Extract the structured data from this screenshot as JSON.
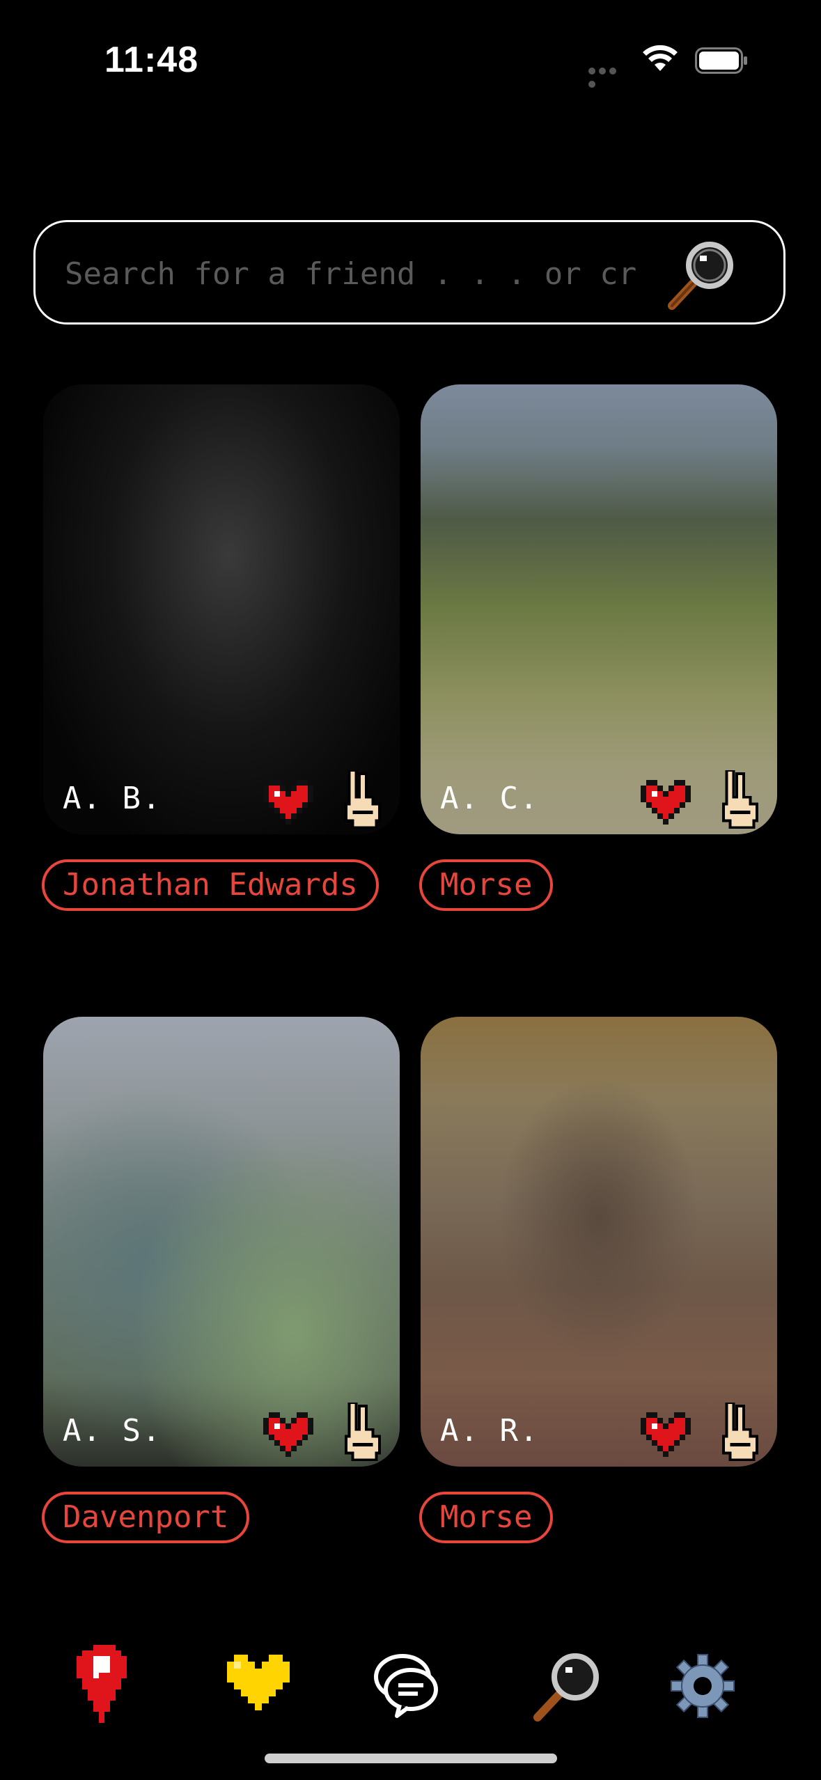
{
  "status_bar": {
    "time": "11:48"
  },
  "search": {
    "placeholder": "Search for a friend . . . or crush"
  },
  "cards": [
    {
      "initials": "A. B.",
      "tag": "Jonathan Edwards"
    },
    {
      "initials": "A. C.",
      "tag": "Morse"
    },
    {
      "initials": "A. S.",
      "tag": "Davenport"
    },
    {
      "initials": "A. R.",
      "tag": "Morse"
    }
  ],
  "tab_bar": {
    "items": [
      {
        "icon": "map-pin-icon"
      },
      {
        "icon": "heart-icon"
      },
      {
        "icon": "chat-icon"
      },
      {
        "icon": "search-icon"
      },
      {
        "icon": "gear-icon"
      }
    ]
  },
  "colors": {
    "accent": "#e8453c",
    "heart": "#e0141b",
    "tab_heart": "#ffd400",
    "background": "#000000"
  }
}
